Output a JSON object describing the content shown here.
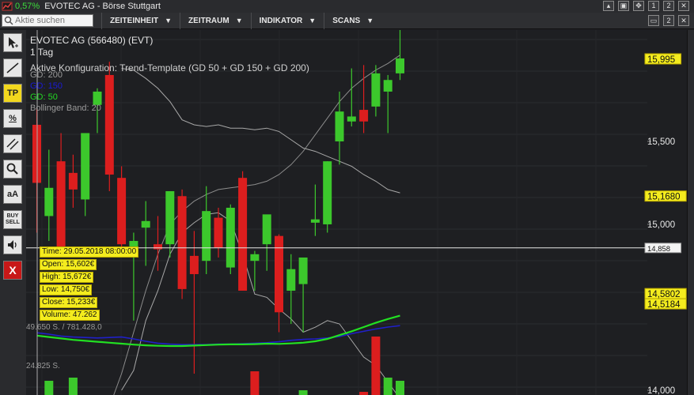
{
  "titlebar": {
    "change_pct": "0,57%",
    "title": "EVOTEC AG - Börse Stuttgart",
    "window_buttons": [
      "▴",
      "▣",
      "✥",
      "1",
      "2",
      "✕"
    ]
  },
  "toolbar": {
    "search_placeholder": "Aktie suchen",
    "menus": [
      "ZEITEINHEIT",
      "ZEITRAUM",
      "INDIKATOR",
      "SCANS"
    ],
    "right_buttons": [
      "▭",
      "2",
      "✕"
    ]
  },
  "tools": [
    {
      "name": "cursor-tool",
      "label": "",
      "icon": "arrow-icon"
    },
    {
      "name": "line-tool",
      "label": "",
      "icon": "line-icon"
    },
    {
      "name": "trend-template-tool",
      "label": "TP",
      "icon": ""
    },
    {
      "name": "percent-tool",
      "label": "%",
      "icon": ""
    },
    {
      "name": "parallel-lines-tool",
      "label": "",
      "icon": "parallel-lines-icon"
    },
    {
      "name": "zoom-tool",
      "label": "",
      "icon": "magnifier-icon"
    },
    {
      "name": "text-tool",
      "label": "aA",
      "icon": ""
    },
    {
      "name": "buy-sell-tool",
      "label": "BUY SELL",
      "icon": ""
    },
    {
      "name": "sound-tool",
      "label": "",
      "icon": "speaker-icon"
    },
    {
      "name": "close-tool",
      "label": "X",
      "icon": ""
    }
  ],
  "chart": {
    "title": "EVOTEC AG (566480) (EVT)",
    "timeframe": "1 Tag",
    "config": "Aktive Konfiguration: Trend-Template (GD 50 + GD 150 + GD 200)",
    "legend": [
      {
        "label": "GD: 200",
        "color": "#9a9a9a"
      },
      {
        "label": "GD: 150",
        "color": "#1a1ad8"
      },
      {
        "label": "GD: 50",
        "color": "#22d822"
      },
      {
        "label": "Bollinger Band: 20",
        "color": "#9a9a9a"
      }
    ],
    "price_labels": [
      {
        "text": "15,995",
        "value": 15.995,
        "highlight": true
      },
      {
        "text": "15,500",
        "value": 15.5,
        "highlight": false
      },
      {
        "text": "15,1680",
        "value": 15.168,
        "highlight": true
      },
      {
        "text": "15,000",
        "value": 15.0,
        "highlight": false
      },
      {
        "text": "14,858",
        "value": 14.858,
        "highlight": "white"
      },
      {
        "text": "14,5802",
        "value": 14.5802,
        "highlight": true
      },
      {
        "text": "14,5184",
        "value": 14.5184,
        "highlight": true
      },
      {
        "text": "14,000",
        "value": 14.0,
        "highlight": false
      }
    ],
    "crosshair_price": 14.858,
    "tooltip": [
      "Time: 29.05.2018 08:00:00",
      "Open: 15,602€",
      "High: 15,672€",
      "Low: 14,750€",
      "Close: 15,233€",
      "Volume: 47.262"
    ],
    "volume_labels": [
      "49.650 S. / 781.428,0",
      "24.825 S."
    ]
  },
  "chart_data": {
    "type": "candlestick",
    "ylim": [
      13.98,
      16.2
    ],
    "candles": [
      {
        "o": 15.6,
        "h": 15.7,
        "l": 14.95,
        "c": 15.25
      },
      {
        "o": 15.05,
        "h": 15.45,
        "l": 14.9,
        "c": 15.22
      },
      {
        "o": 15.38,
        "h": 15.55,
        "l": 14.8,
        "c": 14.82
      },
      {
        "o": 15.31,
        "h": 15.42,
        "l": 15.1,
        "c": 15.21
      },
      {
        "o": 15.15,
        "h": 15.48,
        "l": 15.05,
        "c": 15.55
      },
      {
        "o": 15.72,
        "h": 15.82,
        "l": 15.55,
        "c": 15.8
      },
      {
        "o": 15.9,
        "h": 15.98,
        "l": 15.2,
        "c": 15.3
      },
      {
        "o": 15.28,
        "h": 15.35,
        "l": 14.85,
        "c": 14.88
      },
      {
        "o": 14.82,
        "h": 14.95,
        "l": 14.42,
        "c": 14.9
      },
      {
        "o": 14.98,
        "h": 15.14,
        "l": 14.75,
        "c": 15.02
      },
      {
        "o": 14.88,
        "h": 15.05,
        "l": 14.72,
        "c": 14.85
      },
      {
        "o": 14.88,
        "h": 15.2,
        "l": 14.8,
        "c": 15.2
      },
      {
        "o": 15.17,
        "h": 15.21,
        "l": 14.55,
        "c": 14.61
      },
      {
        "o": 14.81,
        "h": 14.96,
        "l": 14.1,
        "c": 14.7
      },
      {
        "o": 14.78,
        "h": 15.23,
        "l": 14.7,
        "c": 15.08
      },
      {
        "o": 15.04,
        "h": 15.1,
        "l": 14.8,
        "c": 14.86
      },
      {
        "o": 14.74,
        "h": 15.12,
        "l": 14.7,
        "c": 15.1
      },
      {
        "o": 15.28,
        "h": 15.32,
        "l": 14.6,
        "c": 14.6
      },
      {
        "o": 14.78,
        "h": 14.84,
        "l": 14.6,
        "c": 14.82
      },
      {
        "o": 14.88,
        "h": 15.05,
        "l": 14.72,
        "c": 15.06
      },
      {
        "o": 14.93,
        "h": 14.94,
        "l": 14.35,
        "c": 14.47
      },
      {
        "o": 14.6,
        "h": 14.82,
        "l": 14.4,
        "c": 14.73
      },
      {
        "o": 14.64,
        "h": 14.78,
        "l": 14.35,
        "c": 14.8
      },
      {
        "o": 15.01,
        "h": 15.24,
        "l": 14.93,
        "c": 15.03
      },
      {
        "o": 15.0,
        "h": 15.38,
        "l": 14.95,
        "c": 15.38
      },
      {
        "o": 15.5,
        "h": 15.8,
        "l": 15.36,
        "c": 15.68
      },
      {
        "o": 15.62,
        "h": 15.94,
        "l": 15.59,
        "c": 15.65
      },
      {
        "o": 15.69,
        "h": 15.96,
        "l": 15.55,
        "c": 15.62
      },
      {
        "o": 15.71,
        "h": 15.96,
        "l": 15.65,
        "c": 15.91
      },
      {
        "o": 15.8,
        "h": 15.9,
        "l": 15.55,
        "c": 15.87
      },
      {
        "o": 15.91,
        "h": 16.18,
        "l": 15.87,
        "c": 16.0
      }
    ],
    "bollinger_upper": [
      null,
      null,
      null,
      null,
      null,
      null,
      null,
      15.94,
      15.93,
      15.88,
      15.82,
      15.74,
      15.63,
      15.6,
      15.59,
      15.6,
      15.58,
      15.58,
      15.57,
      15.58,
      15.56,
      15.51,
      15.46,
      15.44,
      15.41,
      15.38,
      15.35,
      15.3,
      15.26,
      15.21,
      15.19
    ],
    "bollinger_lower": [
      null,
      null,
      null,
      null,
      null,
      null,
      null,
      14.0,
      14.12,
      14.42,
      14.6,
      14.82,
      14.95,
      15.01,
      15.06,
      15.07,
      15.02,
      14.82,
      14.58,
      14.56,
      14.49,
      14.43,
      14.35,
      14.38,
      14.42,
      14.4,
      14.3,
      14.2,
      14.15,
      14.05,
      13.95
    ],
    "gd200_pane": [
      5,
      5,
      5,
      5,
      5,
      5,
      5,
      5,
      4,
      4,
      4,
      4,
      4,
      3.8,
      3.5,
      3.0,
      2.5,
      2.0,
      2.0,
      2.0,
      2.0,
      2.2,
      2.3,
      2.2,
      2.0,
      1.8,
      1.2,
      0.8,
      0.5,
      0.3,
      0.2
    ],
    "gd150_pane": [
      2.8,
      2.5,
      2.1,
      1.9,
      1.8,
      1.7,
      1.8,
      1.9,
      1.5,
      1.0,
      0.6,
      0.4,
      0.3,
      0.3,
      0.3,
      0.4,
      0.4,
      0.5,
      0.6,
      0.7,
      0.9,
      1.2,
      1.4,
      1.5,
      1.7,
      2.0,
      2.6,
      3.1,
      3.6,
      4.0,
      4.3
    ],
    "gd50_pane": [
      2.2,
      1.9,
      1.6,
      1.3,
      1.1,
      0.9,
      0.7,
      0.5,
      0.3,
      0.15,
      0.05,
      0.0,
      0.0,
      0.1,
      0.2,
      0.3,
      0.35,
      0.35,
      0.4,
      0.5,
      0.45,
      0.55,
      0.7,
      1.0,
      1.5,
      2.3,
      3.1,
      4.0,
      4.9,
      5.7,
      6.4
    ],
    "volumes": [
      0,
      0,
      0,
      0,
      0,
      0,
      0,
      0,
      0,
      0,
      0,
      0,
      0,
      0,
      0,
      0,
      0,
      0,
      0,
      0,
      0,
      0,
      0,
      0,
      0,
      0,
      0,
      0,
      0,
      0,
      0
    ]
  }
}
